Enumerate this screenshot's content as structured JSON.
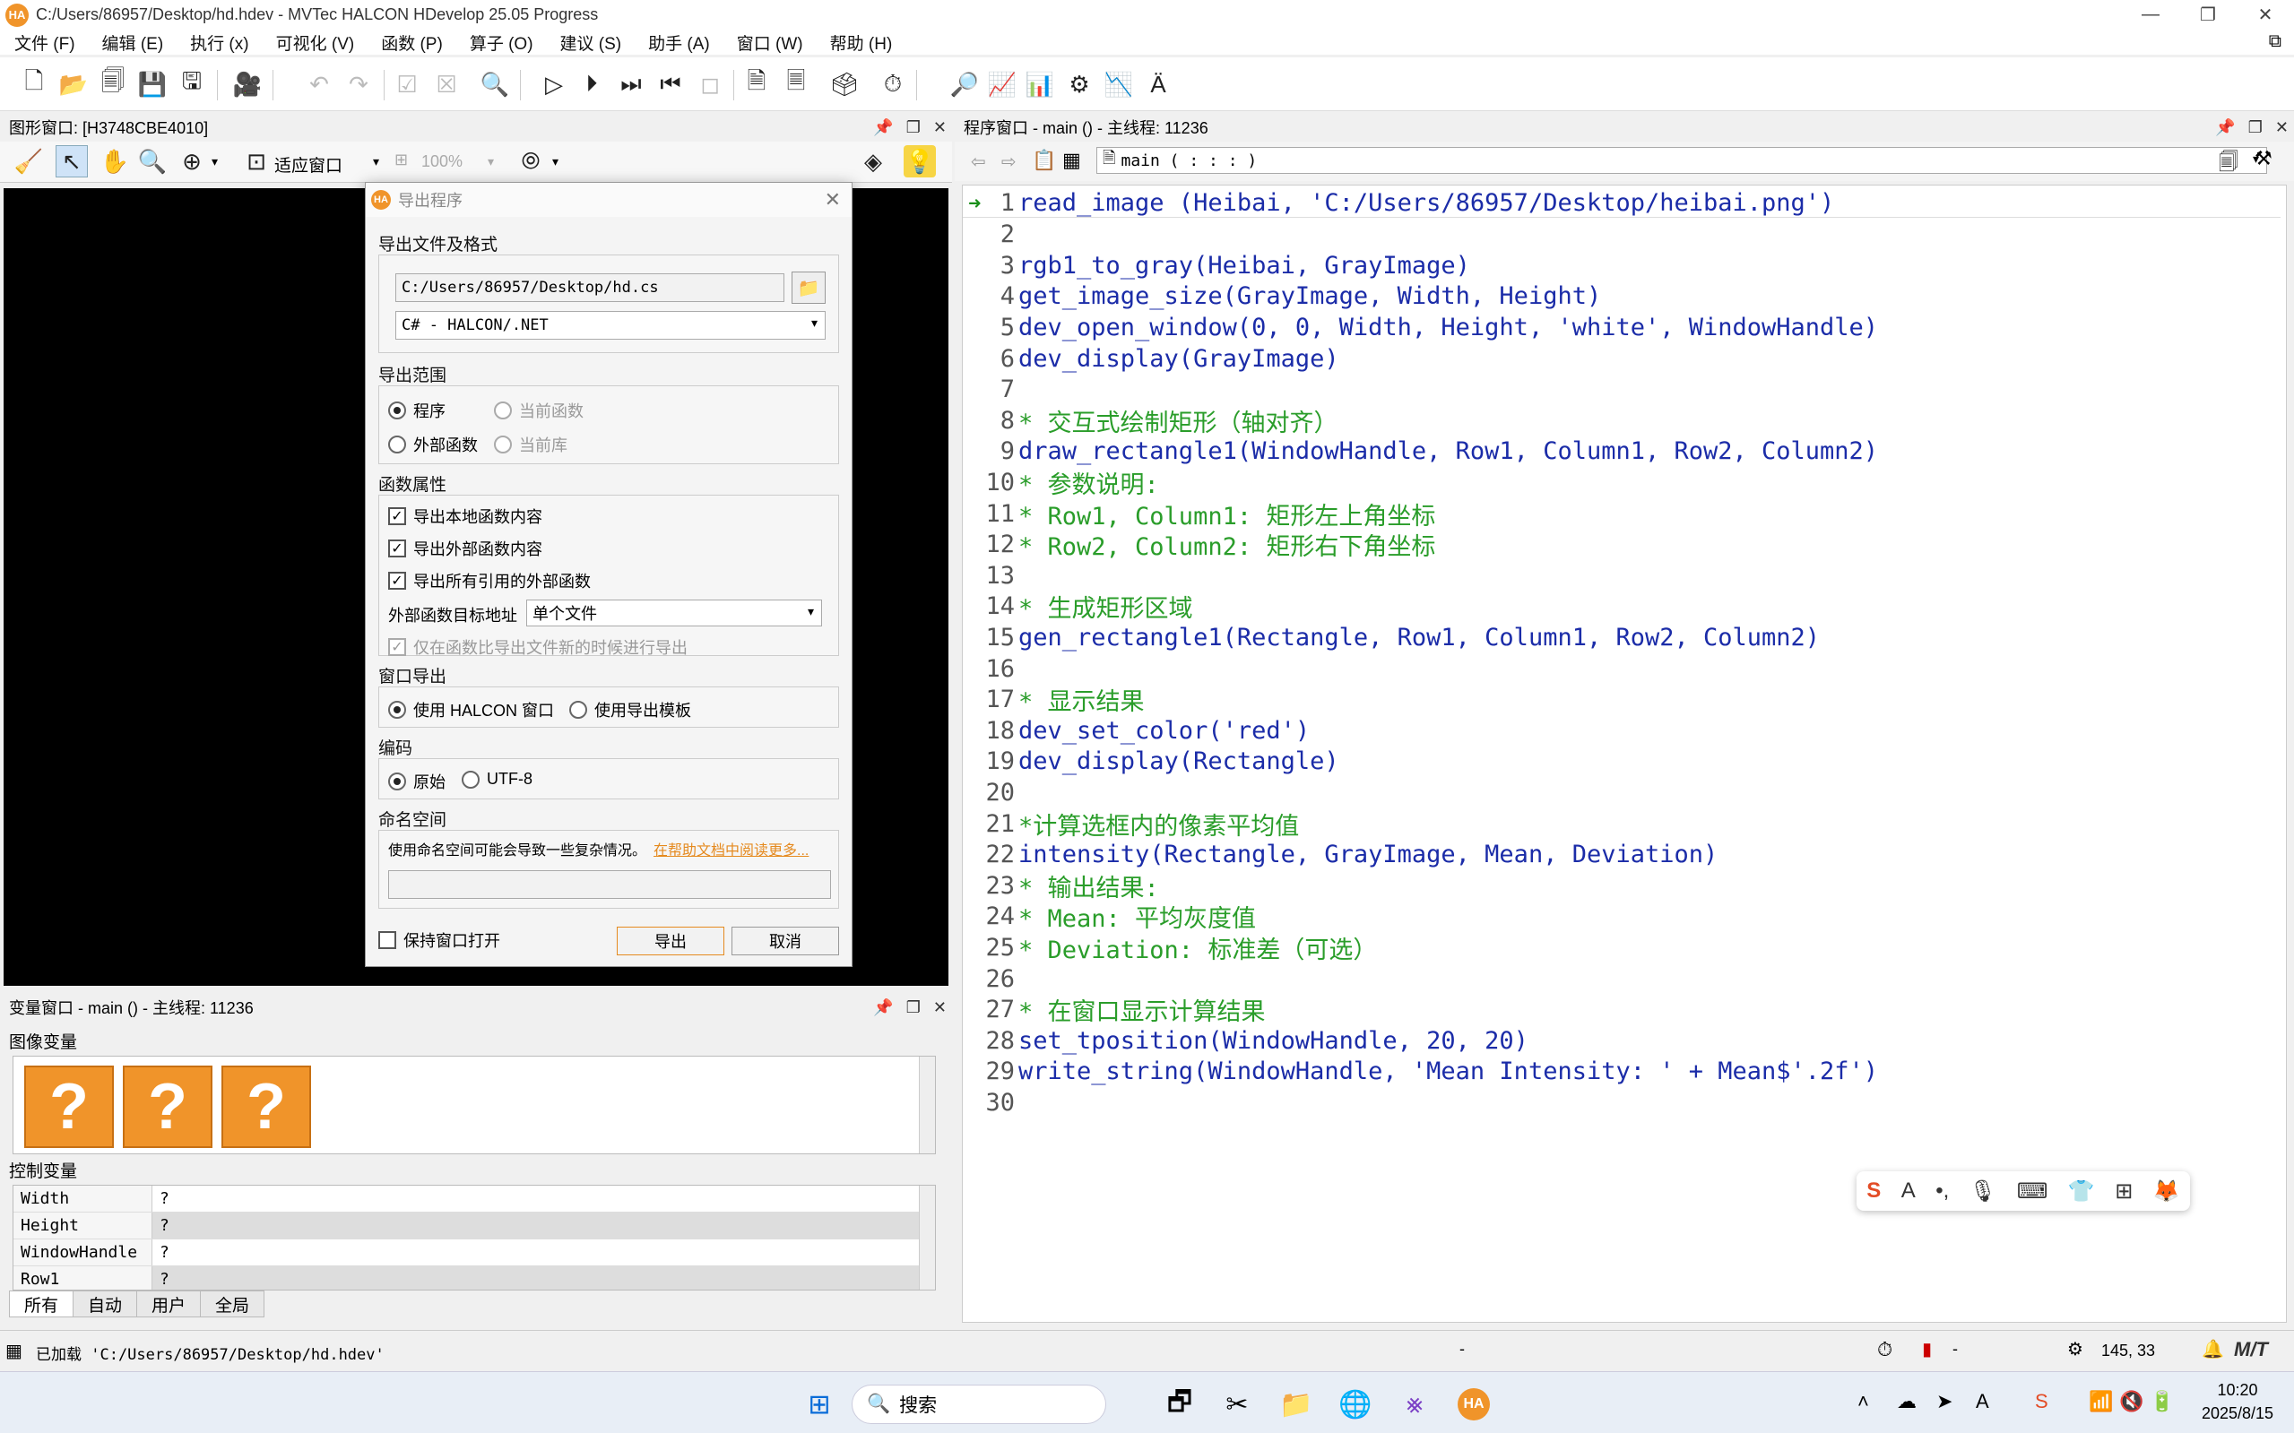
{
  "window": {
    "title": "C:/Users/86957/Desktop/hd.hdev - MVTec HALCON HDevelop 25.05 Progress",
    "logo": "HA"
  },
  "menu": [
    "文件 (F)",
    "编辑 (E)",
    "执行 (x)",
    "可视化 (V)",
    "函数 (P)",
    "算子 (O)",
    "建议 (S)",
    "助手 (A)",
    "窗口 (W)",
    "帮助 (H)"
  ],
  "graphics": {
    "title": "图形窗口: [H3748CBE4010]",
    "fit_label": "适应窗口",
    "zoom_label": "100%"
  },
  "program": {
    "title": "程序窗口 - main () - 主线程: 11236",
    "proc_select": "main ( : : : )",
    "lines": [
      {
        "n": "1",
        "text": "read_image (Heibai, 'C:/Users/86957/Desktop/heibai.png')",
        "kind": "code"
      },
      {
        "n": "2",
        "text": "",
        "kind": "code"
      },
      {
        "n": "3",
        "text": "rgb1_to_gray(Heibai, GrayImage)",
        "kind": "code"
      },
      {
        "n": "4",
        "text": "get_image_size(GrayImage, Width, Height)",
        "kind": "code"
      },
      {
        "n": "5",
        "text": "dev_open_window(0, 0, Width, Height, 'white', WindowHandle)",
        "kind": "code"
      },
      {
        "n": "6",
        "text": "dev_display(GrayImage)",
        "kind": "code"
      },
      {
        "n": "7",
        "text": "",
        "kind": "code"
      },
      {
        "n": "8",
        "text": "* 交互式绘制矩形（轴对齐）",
        "kind": "comment"
      },
      {
        "n": "9",
        "text": "draw_rectangle1(WindowHandle, Row1, Column1, Row2, Column2)",
        "kind": "code"
      },
      {
        "n": "10",
        "text": "* 参数说明:",
        "kind": "comment"
      },
      {
        "n": "11",
        "text": "* Row1, Column1: 矩形左上角坐标",
        "kind": "comment"
      },
      {
        "n": "12",
        "text": "* Row2, Column2: 矩形右下角坐标",
        "kind": "comment"
      },
      {
        "n": "13",
        "text": "",
        "kind": "code"
      },
      {
        "n": "14",
        "text": "* 生成矩形区域",
        "kind": "comment"
      },
      {
        "n": "15",
        "text": "gen_rectangle1(Rectangle, Row1, Column1, Row2, Column2)",
        "kind": "code"
      },
      {
        "n": "16",
        "text": "",
        "kind": "code"
      },
      {
        "n": "17",
        "text": "* 显示结果",
        "kind": "comment"
      },
      {
        "n": "18",
        "text": "dev_set_color('red')",
        "kind": "code"
      },
      {
        "n": "19",
        "text": "dev_display(Rectangle)",
        "kind": "code"
      },
      {
        "n": "20",
        "text": "",
        "kind": "code"
      },
      {
        "n": "21",
        "text": "*计算选框内的像素平均值",
        "kind": "comment"
      },
      {
        "n": "22",
        "text": "intensity(Rectangle, GrayImage, Mean, Deviation)",
        "kind": "code"
      },
      {
        "n": "23",
        "text": "* 输出结果:",
        "kind": "comment"
      },
      {
        "n": "24",
        "text": "* Mean: 平均灰度值",
        "kind": "comment"
      },
      {
        "n": "25",
        "text": "* Deviation: 标准差（可选）",
        "kind": "comment"
      },
      {
        "n": "26",
        "text": "",
        "kind": "code"
      },
      {
        "n": "27",
        "text": "* 在窗口显示计算结果",
        "kind": "comment"
      },
      {
        "n": "28",
        "text": "set_tposition(WindowHandle, 20, 20)",
        "kind": "code"
      },
      {
        "n": "29",
        "text": "write_string(WindowHandle, 'Mean Intensity: ' + Mean$'.2f')",
        "kind": "code"
      },
      {
        "n": "30",
        "text": "",
        "kind": "code"
      }
    ]
  },
  "variables": {
    "title": "变量窗口 - main () - 主线程: 11236",
    "image_section": "图像变量",
    "control_section": "控制变量",
    "image_placeholder": "?",
    "control_rows": [
      {
        "name": "Width",
        "value": "?"
      },
      {
        "name": "Height",
        "value": "?"
      },
      {
        "name": "WindowHandle",
        "value": "?"
      },
      {
        "name": "Row1",
        "value": "?"
      }
    ],
    "tabs": [
      "所有",
      "自动",
      "用户",
      "全局"
    ]
  },
  "dialog": {
    "title": "导出程序",
    "file_section": "导出文件及格式",
    "file_path": "C:/Users/86957/Desktop/hd.cs",
    "format": "C# - HALCON/.NET",
    "range_section": "导出范围",
    "range_options": [
      "程序",
      "当前函数",
      "外部函数",
      "当前库"
    ],
    "func_section": "函数属性",
    "func_checks": [
      "导出本地函数内容",
      "导出外部函数内容",
      "导出所有引用的外部函数"
    ],
    "ext_target_label": "外部函数目标地址",
    "ext_target_value": "单个文件",
    "only_newer": "仅在函数比导出文件新的时候进行导出",
    "window_section": "窗口导出",
    "window_options": [
      "使用 HALCON 窗口",
      "使用导出模板"
    ],
    "encoding_section": "编码",
    "encoding_options": [
      "原始",
      "UTF-8"
    ],
    "ns_section": "命名空间",
    "ns_note": "使用命名空间可能会导致一些复杂情况。",
    "ns_link": "在帮助文档中阅读更多...",
    "keep_open": "保持窗口打开",
    "export_btn": "导出",
    "cancel_btn": "取消"
  },
  "status": {
    "message": "已加载 'C:/Users/86957/Desktop/hd.hdev'",
    "dash1": "-",
    "dash2": "-",
    "coords": "145, 33"
  },
  "taskbar": {
    "search": "搜索",
    "time": "10:20",
    "date": "2025/8/15"
  }
}
